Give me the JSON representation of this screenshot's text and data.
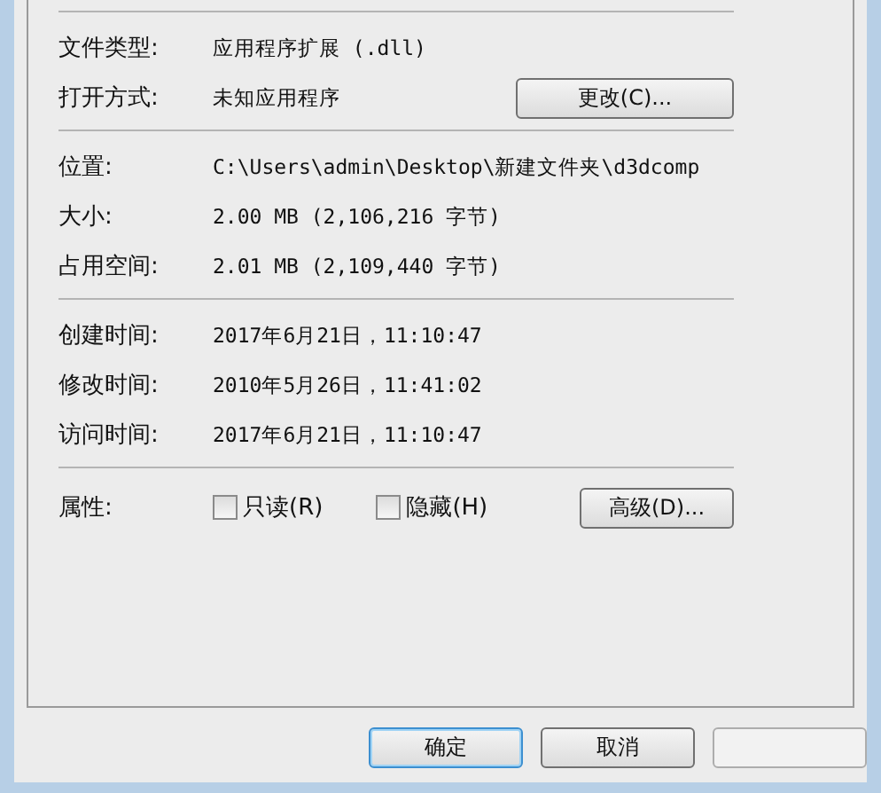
{
  "sections": [
    {
      "rows": [
        {
          "label": "文件类型:",
          "value": "应用程序扩展 (.dll)"
        },
        {
          "label": "打开方式:",
          "value": "未知应用程序",
          "button": "更改(C)..."
        }
      ]
    },
    {
      "rows": [
        {
          "label": "位置:",
          "value": "C:\\Users\\admin\\Desktop\\新建文件夹\\d3dcomp"
        },
        {
          "label": "大小:",
          "value": "2.00 MB (2,106,216 字节)"
        },
        {
          "label": "占用空间:",
          "value": "2.01 MB (2,109,440 字节)"
        }
      ]
    },
    {
      "rows": [
        {
          "label": "创建时间:",
          "value": "2017年6月21日，11:10:47"
        },
        {
          "label": "修改时间:",
          "value": "2010年5月26日，11:41:02"
        },
        {
          "label": "访问时间:",
          "value": "2017年6月21日，11:10:47"
        }
      ]
    }
  ],
  "attributes": {
    "label": "属性:",
    "checkboxes": [
      {
        "label": "只读(R)",
        "checked": false
      },
      {
        "label": "隐藏(H)",
        "checked": false
      }
    ],
    "button": "高级(D)..."
  },
  "buttons": [
    {
      "label": "确定",
      "default": true
    },
    {
      "label": "取消",
      "default": false
    },
    {
      "disabled": true
    }
  ]
}
